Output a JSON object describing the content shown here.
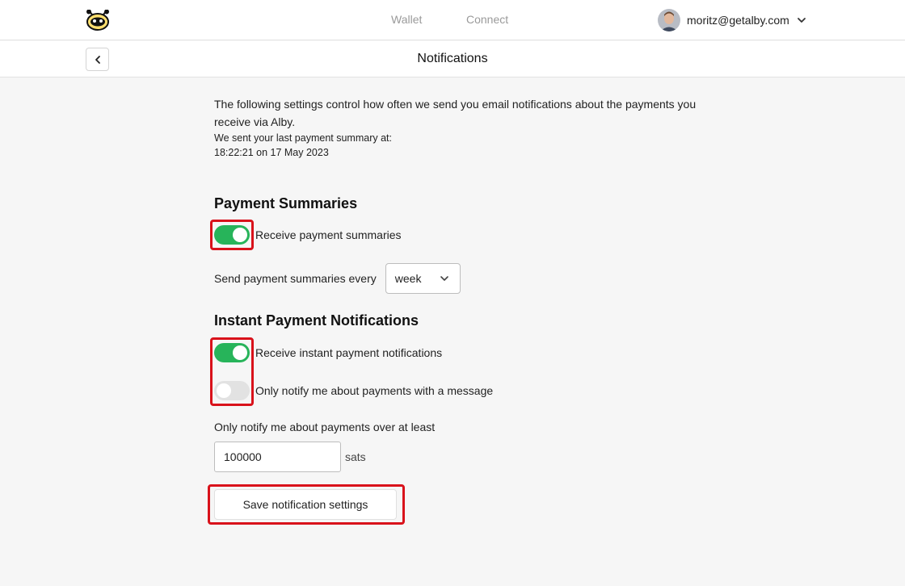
{
  "nav": {
    "logo_icon": "alby-bee-logo-icon",
    "links": {
      "wallet": "Wallet",
      "connect": "Connect"
    },
    "account": {
      "email": "moritz@getalby.com",
      "avatar_icon": "user-avatar",
      "menu_icon": "chevron-down-icon"
    }
  },
  "header": {
    "back_icon": "chevron-left-icon",
    "title": "Notifications"
  },
  "intro": {
    "description": "The following settings control how often we send you email notifications about the payments you receive via Alby.",
    "last_sent_label": "We sent your last payment summary at:",
    "last_sent_time": "18:22:21 on 17 May 2023"
  },
  "payment_summaries": {
    "title": "Payment Summaries",
    "receive_toggle": {
      "label": "Receive payment summaries",
      "on": true
    },
    "frequency": {
      "label": "Send payment summaries every",
      "selected": "week"
    }
  },
  "instant_notifications": {
    "title": "Instant Payment Notifications",
    "receive_toggle": {
      "label": "Receive instant payment notifications",
      "on": true
    },
    "message_only_toggle": {
      "label": "Only notify me about payments with a message",
      "on": false
    },
    "minimum": {
      "label": "Only notify me about payments over at least",
      "value": "100000",
      "unit": "sats"
    }
  },
  "save_button": {
    "label": "Save notification settings"
  },
  "colors": {
    "toggle_on": "#27b45a",
    "toggle_off": "#e2e2e2",
    "highlight": "#d9121b"
  }
}
